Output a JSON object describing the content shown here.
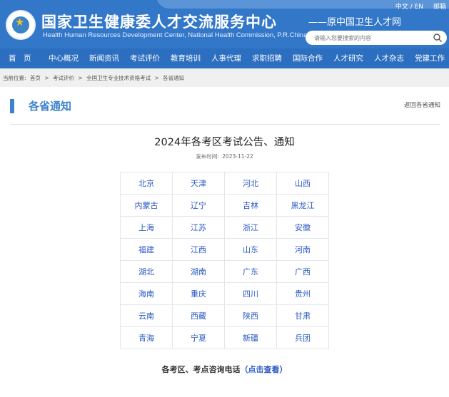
{
  "header": {
    "site_title": "国家卫生健康委人才交流服务中心",
    "site_subtitle": "Health Human Resources Development Center, National Health Commission, P.R.China",
    "lang_switch": "中文 / EN",
    "mail": "邮箱",
    "former_name": "——原中国卫生人才网",
    "search_placeholder": "请输入您要搜索的内容",
    "accent_color": "#3377c9"
  },
  "nav": {
    "items": [
      {
        "label": "首　页"
      },
      {
        "label": "中心概况"
      },
      {
        "label": "新闻资讯"
      },
      {
        "label": "考试评价"
      },
      {
        "label": "教育培训"
      },
      {
        "label": "人事代理"
      },
      {
        "label": "求职招聘"
      },
      {
        "label": "国际合作"
      },
      {
        "label": "人才研究"
      },
      {
        "label": "人才杂志"
      },
      {
        "label": "党建工作"
      }
    ]
  },
  "breadcrumb": {
    "label": "当前位置:",
    "items": [
      "首页",
      ">",
      "考试评价",
      ">",
      "全国卫生专业技术资格考试",
      ">",
      "各省通知"
    ]
  },
  "section": {
    "title": "各省通知",
    "back_link": "返回各省通知"
  },
  "article": {
    "title": "2024年各考区考试公告、通知",
    "publish_label": "发布时间:",
    "publish_date": "2023-11-22"
  },
  "provinces": [
    [
      "北京",
      "天津",
      "河北",
      "山西"
    ],
    [
      "内蒙古",
      "辽宁",
      "吉林",
      "黑龙江"
    ],
    [
      "上海",
      "江苏",
      "浙江",
      "安徽"
    ],
    [
      "福建",
      "江西",
      "山东",
      "河南"
    ],
    [
      "湖北",
      "湖南",
      "广东",
      "广西"
    ],
    [
      "海南",
      "重庆",
      "四川",
      "贵州"
    ],
    [
      "云南",
      "西藏",
      "陕西",
      "甘肃"
    ],
    [
      "青海",
      "宁夏",
      "新疆",
      "兵团"
    ]
  ],
  "hotline": {
    "text": "各考区、考点咨询电话",
    "link_open": "（",
    "link": "点击查看",
    "link_close": "）"
  }
}
